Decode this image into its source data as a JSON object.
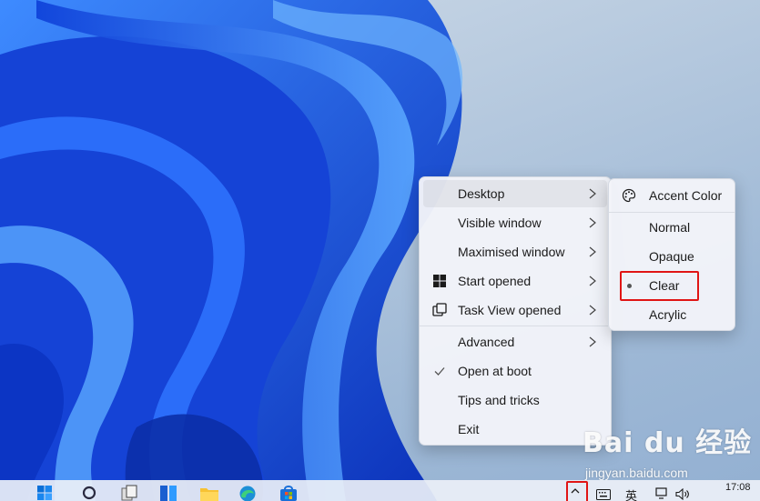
{
  "main_menu": {
    "items": [
      {
        "label": "Desktop",
        "icon": "none",
        "has_submenu": true
      },
      {
        "label": "Visible window",
        "icon": "none",
        "has_submenu": true
      },
      {
        "label": "Maximised window",
        "icon": "none",
        "has_submenu": true
      },
      {
        "label": "Start opened",
        "icon": "windows-logo-icon",
        "has_submenu": true
      },
      {
        "label": "Task View opened",
        "icon": "task-view-icon",
        "has_submenu": true
      },
      {
        "label": "Advanced",
        "icon": "none",
        "has_submenu": true
      },
      {
        "label": "Open at boot",
        "icon": "checkmark-icon",
        "checked": true
      },
      {
        "label": "Tips and tricks",
        "icon": "none"
      },
      {
        "label": "Exit",
        "icon": "none"
      }
    ]
  },
  "sub_menu": {
    "items": [
      {
        "label": "Accent Color",
        "icon": "palette-icon"
      },
      {
        "label": "Normal"
      },
      {
        "label": "Opaque"
      },
      {
        "label": "Clear",
        "selected": true,
        "highlighted": true
      },
      {
        "label": "Acrylic"
      }
    ]
  },
  "taskbar": {
    "tray_input_language": "英",
    "clock_time": "17:08"
  },
  "watermark": {
    "logo": "Bai du 经验",
    "url": "jingyan.baidu.com"
  },
  "colors": {
    "highlight_box": "#e01515",
    "wallpaper_blue": "#1a4fe0",
    "menu_bg": "#f2f4f9"
  }
}
